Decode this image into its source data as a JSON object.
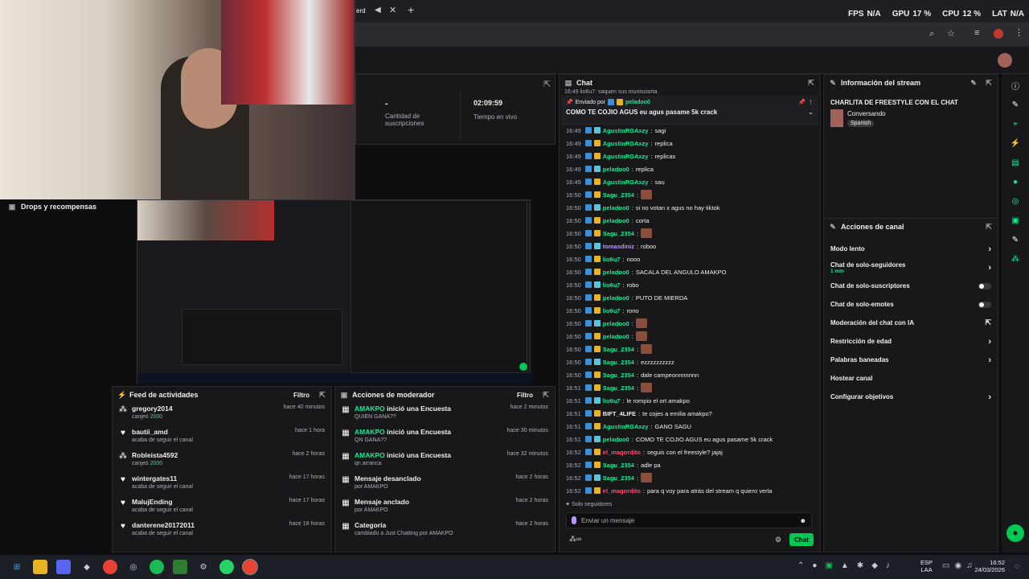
{
  "browser": {
    "tab_title": "erd",
    "fps_label": "FPS",
    "fps_value": "N/A",
    "gpu_label": "GPU",
    "gpu_value": "17 %",
    "cpu_label": "CPU",
    "cpu_value": "12 %",
    "lat_label": "LAT",
    "lat_value": "N/A"
  },
  "drops": {
    "label": "Drops y recompensas"
  },
  "stats": {
    "subs_value": "-",
    "subs_label": "Cantidad de suscripciones",
    "live_time": "02:09:59",
    "live_label": "Tiempo en vivo"
  },
  "feed": {
    "title": "Feed de actividades",
    "filter": "Filtro",
    "items": [
      {
        "name": "gregory2014",
        "sub_prefix": "canjeó",
        "sub_value": "2000",
        "time": "hace 40 minutos",
        "icon": "points"
      },
      {
        "name": "bautii_amd",
        "sub_prefix": "acaba de seguir el canal",
        "sub_value": "",
        "time": "hace 1 hora",
        "icon": "heart"
      },
      {
        "name": "Robleista4592",
        "sub_prefix": "canjeó",
        "sub_value": "2000",
        "time": "hace 2 horas",
        "icon": "points"
      },
      {
        "name": "wintergates11",
        "sub_prefix": "acaba de seguir el canal",
        "sub_value": "",
        "time": "hace 17 horas",
        "icon": "heart"
      },
      {
        "name": "MalujEnding",
        "sub_prefix": "acaba de seguir el canal",
        "sub_value": "",
        "time": "hace 17 horas",
        "icon": "heart"
      },
      {
        "name": "danterene20172011",
        "sub_prefix": "acaba de seguir el canal",
        "sub_value": "",
        "time": "hace 18 horas",
        "icon": "heart"
      }
    ]
  },
  "mod": {
    "title": "Acciones de moderador",
    "filter": "Filtro",
    "items": [
      {
        "actor": "AMAKPO",
        "action": "inició una Encuesta",
        "sub": "QUIEN GANA??",
        "time": "hace 2 minutos"
      },
      {
        "actor": "AMAKPO",
        "action": "inició una Encuesta",
        "sub": "QN GANA??",
        "time": "hace 30 minutos"
      },
      {
        "actor": "AMAKPO",
        "action": "inició una Encuesta",
        "sub": "qn arranca",
        "time": "hace 32 minutos"
      },
      {
        "actor": "",
        "action": "Mensaje desanclado",
        "sub": "por AMAKPO",
        "time": "hace 2 horas"
      },
      {
        "actor": "",
        "action": "Mensaje anclado",
        "sub": "por AMAKPO",
        "time": "hace 2 horas"
      },
      {
        "actor": "",
        "action": "Categoría",
        "sub": "cambiado a Just Chatting por AMAKPO",
        "time": "hace 2 horas"
      }
    ]
  },
  "chat": {
    "title": "Chat",
    "pinned_by": "Enviado por",
    "pinned_user": "peladoo0",
    "pinned_msg": "COMO TE COJIO AGUS eu agus pasame 5k crack",
    "top_partial": "16:49 lio6u7: saquen sus munisciorta",
    "lines": [
      {
        "t": "16:49",
        "u": "AgustinRGAxzy",
        "m": "sagi",
        "c": "#00f593"
      },
      {
        "t": "16:49",
        "u": "AgustinRGAxzy",
        "m": "replica",
        "c": "#00f593"
      },
      {
        "t": "16:49",
        "u": "AgustinRGAxzy",
        "m": "replicas",
        "c": "#00f593"
      },
      {
        "t": "16:49",
        "u": "peladoo0",
        "m": "replica",
        "c": "#00f593"
      },
      {
        "t": "16:49",
        "u": "AgustinRGAxzy",
        "m": "sau",
        "c": "#00f593"
      },
      {
        "t": "16:50",
        "u": "Sagu_2354",
        "m": "",
        "c": "#00f593"
      },
      {
        "t": "16:50",
        "u": "peladoo0",
        "m": "si no votan x agus no hay tiktok",
        "c": "#00f593"
      },
      {
        "t": "16:50",
        "u": "peladoo0",
        "m": "corta",
        "c": "#00f593"
      },
      {
        "t": "16:50",
        "u": "Sagu_2354",
        "m": "",
        "c": "#00f593"
      },
      {
        "t": "16:50",
        "u": "tomasdiniz",
        "m": "roboo",
        "c": "#bf94ff"
      },
      {
        "t": "16:50",
        "u": "lio6u7",
        "m": "nooo",
        "c": "#00f593"
      },
      {
        "t": "16:50",
        "u": "peladoo0",
        "m": "SACALA DEL ANGULO AMAKPO",
        "c": "#00f593"
      },
      {
        "t": "16:50",
        "u": "lio6u7",
        "m": "robo",
        "c": "#00f593"
      },
      {
        "t": "16:50",
        "u": "peladoo0",
        "m": "PUTO DE MIERDA",
        "c": "#00f593"
      },
      {
        "t": "16:50",
        "u": "lio6u7",
        "m": "rono",
        "c": "#00f593"
      },
      {
        "t": "16:50",
        "u": "peladoo0",
        "m": "",
        "c": "#00f593"
      },
      {
        "t": "16:50",
        "u": "peladoo0",
        "m": "",
        "c": "#00f593"
      },
      {
        "t": "16:50",
        "u": "Sagu_2354",
        "m": "",
        "c": "#00f593"
      },
      {
        "t": "16:50",
        "u": "Sagu_2354",
        "m": "ezzzzzzzzzz",
        "c": "#00f593"
      },
      {
        "t": "16:50",
        "u": "Sagu_2354",
        "m": "dale campeonnnnnnn",
        "c": "#00f593"
      },
      {
        "t": "16:51",
        "u": "Sagu_2354",
        "m": "",
        "c": "#00f593"
      },
      {
        "t": "16:51",
        "u": "lio6u7",
        "m": "le rompio el ort amakpo",
        "c": "#00f593"
      },
      {
        "t": "16:51",
        "u": "BIFT_4LIFE",
        "m": "te cojes a emilia amakpo?",
        "c": "#efeff1"
      },
      {
        "t": "16:51",
        "u": "AgustinRGAxzy",
        "m": "GANO SAGU",
        "c": "#00f593"
      },
      {
        "t": "16:51",
        "u": "peladoo0",
        "m": "COMO TE COJIO AGUS eu agus pasame 5k crack",
        "c": "#00f593"
      },
      {
        "t": "16:52",
        "u": "el_magordito",
        "m": "seguis con el freestyle? jajaj",
        "c": "#ff4d6d"
      },
      {
        "t": "16:52",
        "u": "Sagu_2354",
        "m": "adle pa",
        "c": "#00f593"
      },
      {
        "t": "16:52",
        "u": "Sagu_2354",
        "m": "",
        "c": "#00f593"
      },
      {
        "t": "16:52",
        "u": "el_magordito",
        "m": "para q voy para atrás del stream q quiero verla",
        "c": "#ff4d6d"
      }
    ],
    "followers_only": "Solo seguidores",
    "input_placeholder": "Enviar un mensaje",
    "send": "Chat"
  },
  "info": {
    "title": "Información del stream",
    "stream_title": "CHARLITA DE FREESTYLE CON EL CHAT",
    "category": "Conversando",
    "tag": "Spanish"
  },
  "actions": {
    "title": "Acciones de canal",
    "items": [
      {
        "label": "Modo lento",
        "sub": "",
        "ctrl": "chevron"
      },
      {
        "label": "Chat de solo-seguidores",
        "sub": "1 min",
        "ctrl": "chevron"
      },
      {
        "label": "Chat de solo-suscriptores",
        "sub": "",
        "ctrl": "toggle"
      },
      {
        "label": "Chat de solo-emotes",
        "sub": "",
        "ctrl": "toggle"
      },
      {
        "label": "Moderación del chat con IA",
        "sub": "",
        "ctrl": "external"
      },
      {
        "label": "Restricción de edad",
        "sub": "",
        "ctrl": "chevron"
      },
      {
        "label": "Palabras baneadas",
        "sub": "",
        "ctrl": "chevron"
      },
      {
        "label": "Hostear canal",
        "sub": "",
        "ctrl": "none"
      },
      {
        "label": "Configurar objetivos",
        "sub": "",
        "ctrl": "chevron"
      }
    ]
  },
  "taskbar": {
    "lang": "ESP",
    "lang2": "LAA",
    "time": "16:52",
    "date": "24/03/2026"
  }
}
